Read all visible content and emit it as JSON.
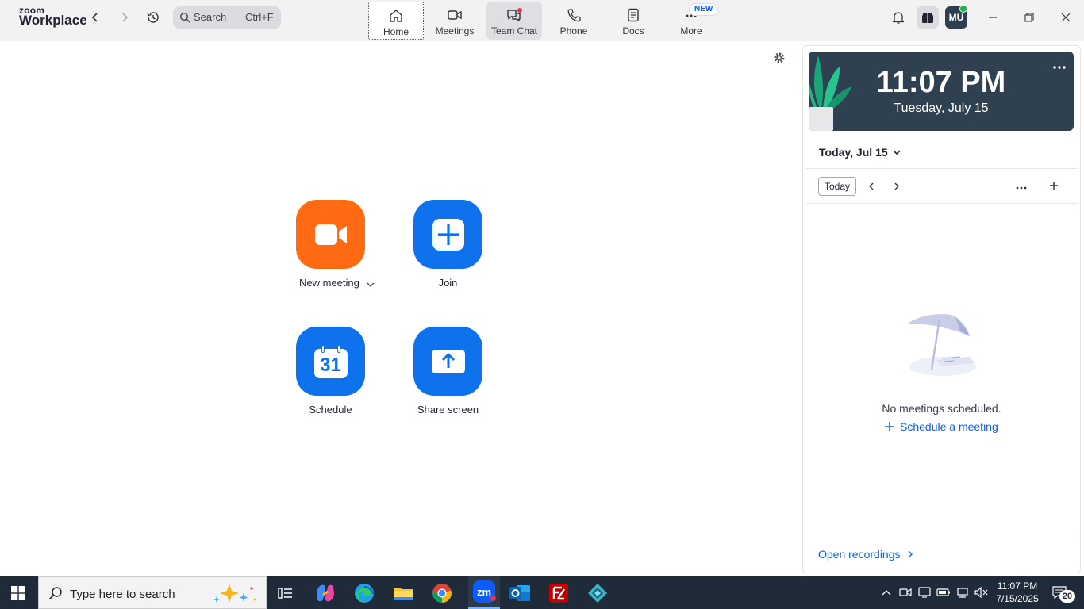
{
  "app": {
    "logo_top": "zoom",
    "logo_bottom": "Workplace"
  },
  "search": {
    "label": "Search",
    "shortcut": "Ctrl+F"
  },
  "tabs": [
    {
      "label": "Home"
    },
    {
      "label": "Meetings"
    },
    {
      "label": "Team Chat"
    },
    {
      "label": "Phone"
    },
    {
      "label": "Docs"
    },
    {
      "label": "More",
      "badge": "NEW"
    }
  ],
  "user": {
    "initials": "MU",
    "status_color": "#22b14c"
  },
  "actions": {
    "new_meeting": "New meeting",
    "join": "Join",
    "schedule": "Schedule",
    "schedule_day": "31",
    "share_screen": "Share screen"
  },
  "colors": {
    "orange": "#ff6a13",
    "blue": "#0e72ed",
    "accent_link": "#0b5cff",
    "clock_bg": "#2f4050"
  },
  "panel": {
    "time": "11:07 PM",
    "date": "Tuesday, July 15",
    "day_selector": "Today, Jul 15",
    "today_button": "Today",
    "empty_text": "No meetings scheduled.",
    "schedule_link": "Schedule a meeting",
    "open_recordings": "Open recordings"
  },
  "taskbar": {
    "search_placeholder": "Type here to search",
    "time": "11:07 PM",
    "date": "7/15/2025",
    "notifications": "20"
  }
}
